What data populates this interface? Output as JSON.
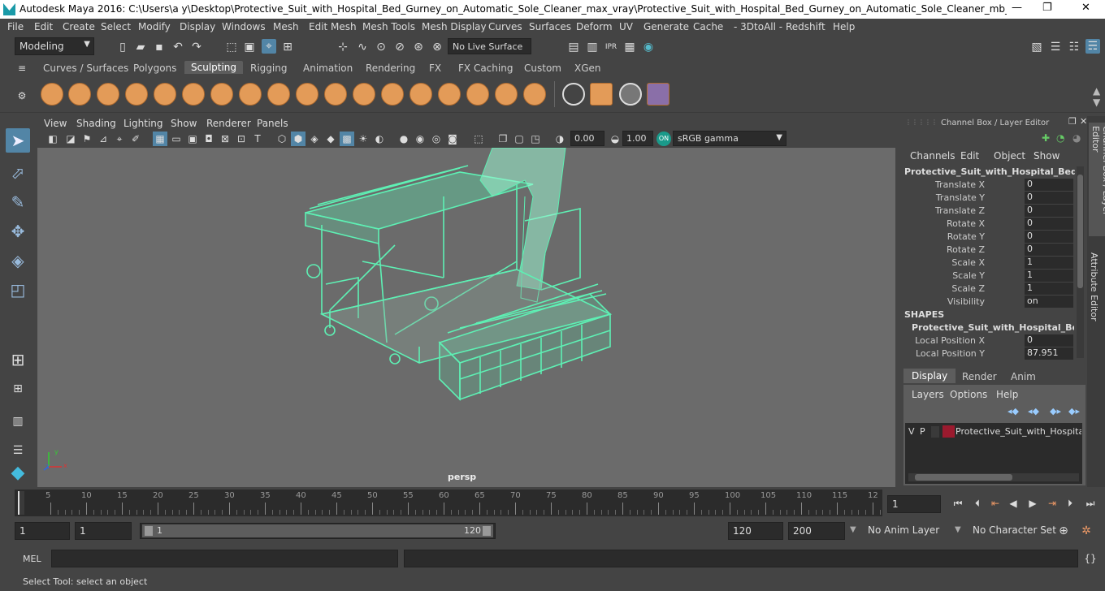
{
  "titlebar": {
    "title": "Autodesk Maya 2016: C:\\Users\\a y\\Desktop\\Protective_Suit_with_Hospital_Bed_Gurney_on_Automatic_Sole_Cleaner_max_vray\\Protective_Suit_with_Hospital_Bed_Gurney_on_Automatic_Sole_Cleaner_mb_vray.mb*  ---  Protec...",
    "minimize": "—",
    "maximize": "❐",
    "close": "✕"
  },
  "menubar": [
    "File",
    "Edit",
    "Create",
    "Select",
    "Modify",
    "Display",
    "Windows",
    "Mesh",
    "Edit Mesh",
    "Mesh Tools",
    "Mesh Display",
    "Curves",
    "Surfaces",
    "Deform",
    "UV",
    "Generate",
    "Cache",
    "- 3DtoAll -",
    "Redshift",
    "Help"
  ],
  "statusline": {
    "mode": "Modeling",
    "live_surface": "No Live Surface"
  },
  "shelf_tabs": [
    "Curves / Surfaces",
    "Polygons",
    "Sculpting",
    "Rigging",
    "Animation",
    "Rendering",
    "FX",
    "FX Caching",
    "Custom",
    "XGen"
  ],
  "active_shelf_tab": "Sculpting",
  "viewport": {
    "menus": [
      "View",
      "Shading",
      "Lighting",
      "Show",
      "Renderer",
      "Panels"
    ],
    "exposure": "0.00",
    "gamma": "1.00",
    "colorspace": "sRGB gamma",
    "camera_label": "persp"
  },
  "channel_box": {
    "title": "Channel Box / Layer Editor",
    "menus": [
      "Channels",
      "Edit",
      "Object",
      "Show"
    ],
    "object_name": "Protective_Suit_with_Hospital_Bed_Gu...",
    "attributes": [
      {
        "name": "Translate X",
        "value": "0"
      },
      {
        "name": "Translate Y",
        "value": "0"
      },
      {
        "name": "Translate Z",
        "value": "0"
      },
      {
        "name": "Rotate X",
        "value": "0"
      },
      {
        "name": "Rotate Y",
        "value": "0"
      },
      {
        "name": "Rotate Z",
        "value": "0"
      },
      {
        "name": "Scale X",
        "value": "1"
      },
      {
        "name": "Scale Y",
        "value": "1"
      },
      {
        "name": "Scale Z",
        "value": "1"
      },
      {
        "name": "Visibility",
        "value": "on"
      }
    ],
    "shapes_header": "SHAPES",
    "shape_name": "Protective_Suit_with_Hospital_Bed_...",
    "shape_attributes": [
      {
        "name": "Local Position X",
        "value": "0"
      },
      {
        "name": "Local Position Y",
        "value": "87.951"
      }
    ]
  },
  "layer_editor": {
    "tabs": [
      "Display",
      "Render",
      "Anim"
    ],
    "active_tab": "Display",
    "menus": [
      "Layers",
      "Options",
      "Help"
    ],
    "layer": {
      "v": "V",
      "p": "P",
      "name": "Protective_Suit_with_Hospital_B",
      "color": "#9b1a2e"
    }
  },
  "side_tabs": [
    "Channel Box / Layer Editor",
    "Attribute Editor"
  ],
  "timeline": {
    "ticks": [
      "5",
      "10",
      "15",
      "20",
      "25",
      "30",
      "35",
      "40",
      "45",
      "50",
      "55",
      "60",
      "65",
      "70",
      "75",
      "80",
      "85",
      "90",
      "95",
      "100",
      "105",
      "110",
      "115",
      "12"
    ],
    "start_marker": "1",
    "current_frame": "1"
  },
  "range": {
    "start": "1",
    "playback_start": "1",
    "slider_start": "1",
    "slider_end": "120",
    "playback_end": "120",
    "end": "200",
    "anim_layer": "No Anim Layer",
    "character_set": "No Character Set"
  },
  "mel": {
    "label": "MEL"
  },
  "help_line": "Select Tool: select an object",
  "colors": {
    "wireframe": "#5ef0b4",
    "accent": "#5285a6",
    "shelf_icon": "#e39b58"
  }
}
